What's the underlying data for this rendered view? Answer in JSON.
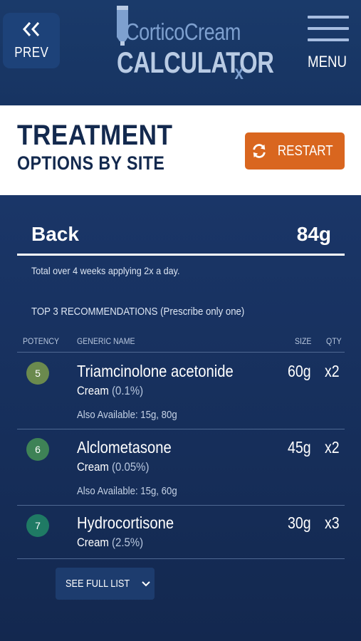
{
  "header": {
    "prev_label": "PREV",
    "logo_line1": "CorticoCream",
    "logo_line2": "CALCULATOR",
    "logo_rx": "x",
    "menu_label": "MENU"
  },
  "page": {
    "title_line1": "TREATMENT",
    "title_line2": "OPTIONS BY SITE",
    "restart_label": "RESTART"
  },
  "site": {
    "name": "Back",
    "total": "84g",
    "note": "Total over 4 weeks applying 2x a day."
  },
  "recommendations": {
    "heading": "TOP 3 RECOMMENDATIONS (Prescribe only one)",
    "columns": {
      "potency": "POTENCY",
      "generic_name": "GENERIC NAME",
      "size": "SIZE",
      "qty": "QTY"
    },
    "rows": [
      {
        "potency": "5",
        "badge_color": "#6b8a4e",
        "name": "Triamcinolone acetonide",
        "form": "Cream",
        "strength": "(0.1%)",
        "also": "Also Available: 15g, 80g",
        "size": "60g",
        "qty": "x2"
      },
      {
        "potency": "6",
        "badge_color": "#3e8256",
        "name": "Alclometasone",
        "form": "Cream",
        "strength": "(0.05%)",
        "also": "Also Available: 15g, 60g",
        "size": "45g",
        "qty": "x2"
      },
      {
        "potency": "7",
        "badge_color": "#1f7a64",
        "name": "Hydrocortisone",
        "form": "Cream",
        "strength": "(2.5%)",
        "also": "",
        "size": "30g",
        "qty": "x3"
      }
    ],
    "see_full_label": "SEE FULL LIST"
  },
  "icons": {
    "prev": "double-chevron-left-icon",
    "menu": "hamburger-icon",
    "restart": "refresh-icon",
    "expand": "chevron-down-icon",
    "logo": "cream-tube-icon"
  }
}
